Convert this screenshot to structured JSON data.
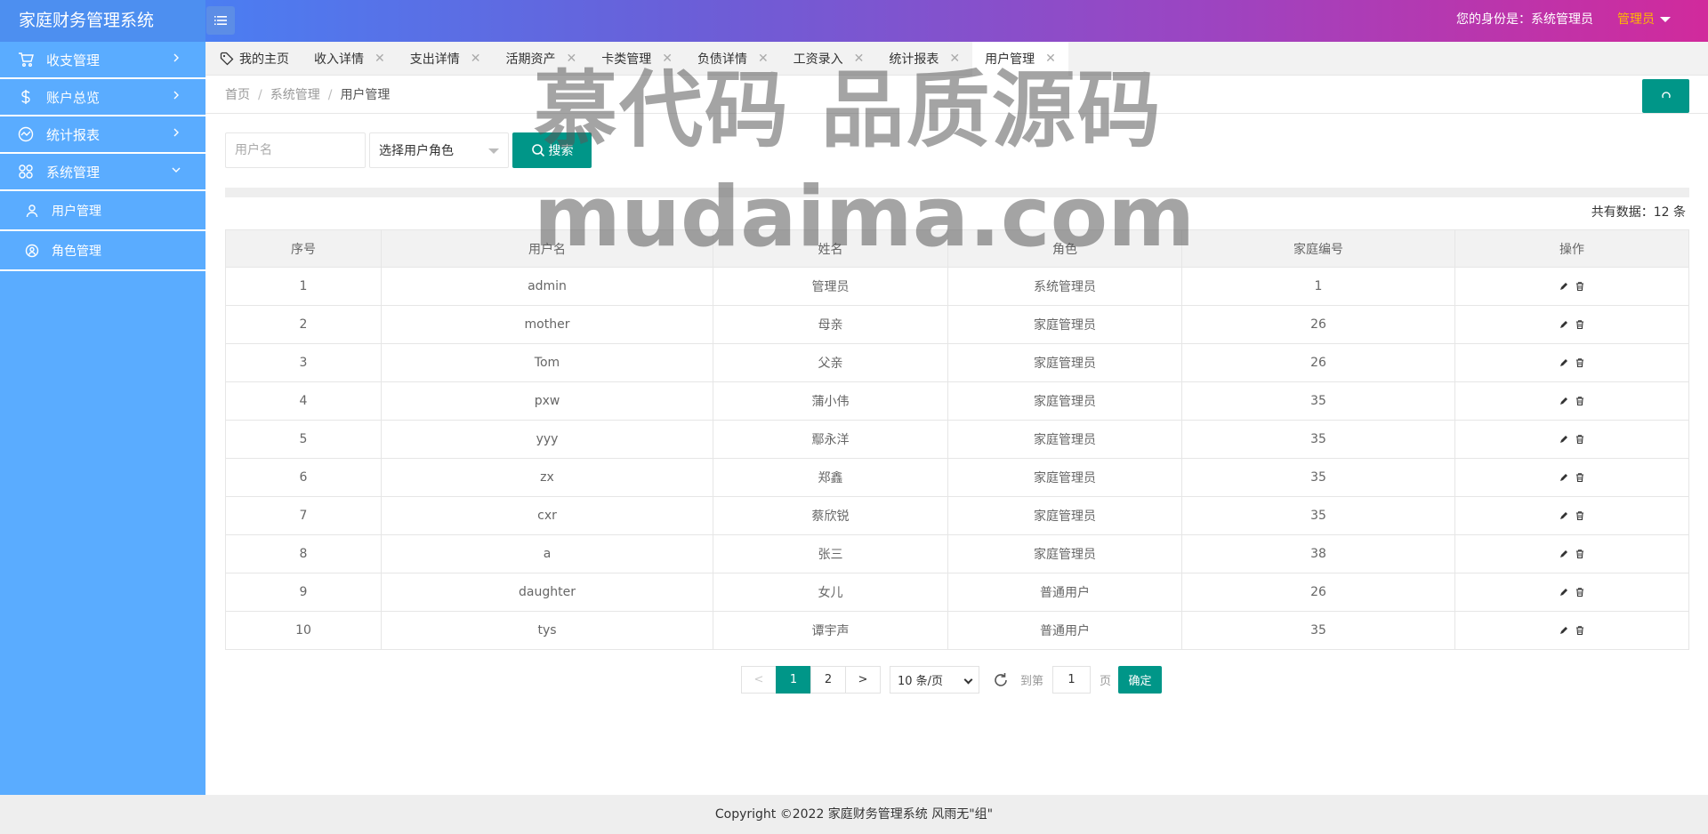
{
  "header": {
    "title": "家庭财务管理系统",
    "identity_label": "您的身份是：系统管理员",
    "user_menu_label": "管理员"
  },
  "sidebar": {
    "items": [
      {
        "label": "收支管理",
        "icon": "cart-icon"
      },
      {
        "label": "账户总览",
        "icon": "dollar-icon"
      },
      {
        "label": "统计报表",
        "icon": "chart-icon"
      },
      {
        "label": "系统管理",
        "icon": "apps-icon",
        "expanded": true,
        "children": [
          {
            "label": "用户管理",
            "icon": "user-icon"
          },
          {
            "label": "角色管理",
            "icon": "role-icon"
          }
        ]
      }
    ]
  },
  "tabs": [
    {
      "label": "我的主页"
    },
    {
      "label": "收入详情"
    },
    {
      "label": "支出详情"
    },
    {
      "label": "活期资产"
    },
    {
      "label": "卡类管理"
    },
    {
      "label": "负债详情"
    },
    {
      "label": "工资录入"
    },
    {
      "label": "统计报表"
    },
    {
      "label": "用户管理",
      "active": true
    }
  ],
  "breadcrumb": {
    "items": [
      "首页",
      "系统管理",
      "用户管理"
    ],
    "separator": "/"
  },
  "search": {
    "username_placeholder": "用户名",
    "role_select_value": "选择用户角色",
    "button_label": "搜索"
  },
  "total_text": "共有数据：12 条",
  "table": {
    "headers": [
      "序号",
      "用户名",
      "姓名",
      "角色",
      "家庭编号",
      "操作"
    ],
    "rows": [
      [
        "1",
        "admin",
        "管理员",
        "系统管理员",
        "1"
      ],
      [
        "2",
        "mother",
        "母亲",
        "家庭管理员",
        "26"
      ],
      [
        "3",
        "Tom",
        "父亲",
        "家庭管理员",
        "26"
      ],
      [
        "4",
        "pxw",
        "蒲小伟",
        "家庭管理员",
        "35"
      ],
      [
        "5",
        "yyy",
        "鄢永洋",
        "家庭管理员",
        "35"
      ],
      [
        "6",
        "zx",
        "郑鑫",
        "家庭管理员",
        "35"
      ],
      [
        "7",
        "cxr",
        "蔡欣锐",
        "家庭管理员",
        "35"
      ],
      [
        "8",
        "a",
        "张三",
        "家庭管理员",
        "38"
      ],
      [
        "9",
        "daughter",
        "女儿",
        "普通用户",
        "26"
      ],
      [
        "10",
        "tys",
        "谭宇声",
        "普通用户",
        "35"
      ]
    ]
  },
  "pagination": {
    "prev": "<",
    "pages": [
      "1",
      "2"
    ],
    "current": "1",
    "next": ">",
    "page_size": "10 条/页",
    "goto_label": "到第",
    "goto_value": "1",
    "page_label": "页",
    "confirm_label": "确定"
  },
  "footer": {
    "text": "Copyright ©2022 家庭财务管理系统 风雨无\"组\""
  },
  "watermark": {
    "line1": "慕代码 品质源码",
    "line2": "mudaima.com"
  },
  "colors": {
    "primary": "#009688",
    "sidebar": "#5aacff",
    "accent": "#ffb800"
  }
}
